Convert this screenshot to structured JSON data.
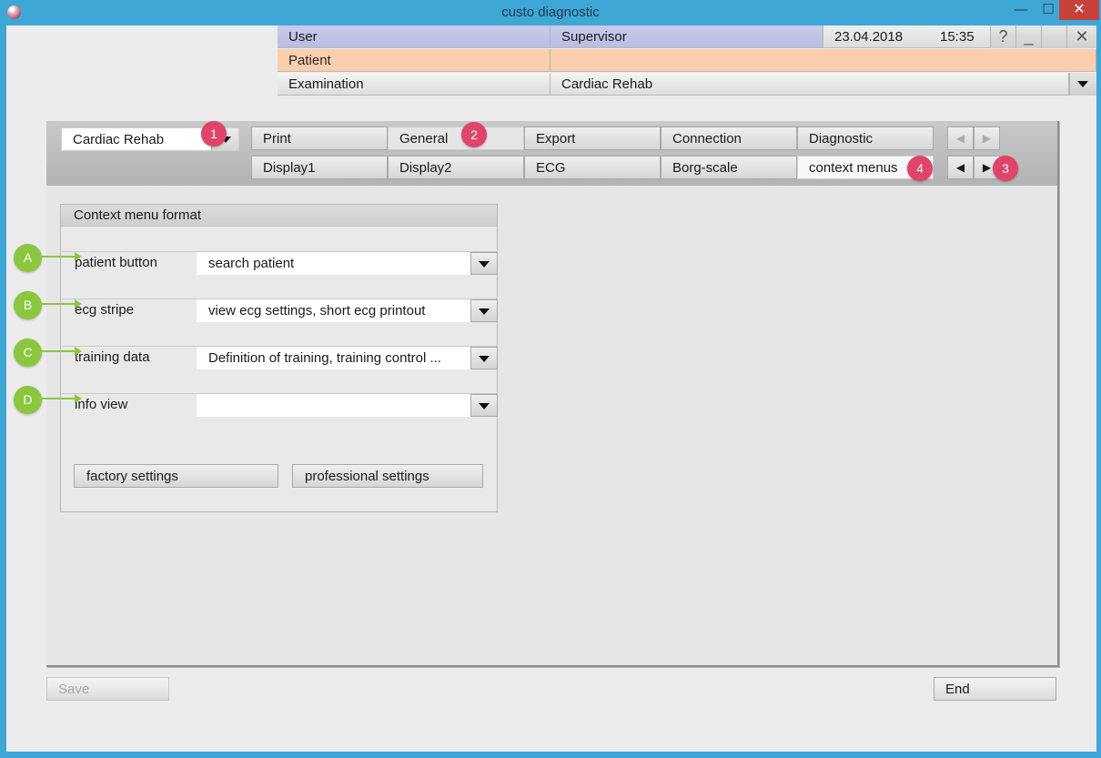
{
  "window": {
    "title": "custo diagnostic"
  },
  "header": {
    "user_label": "User",
    "user_value": "Supervisor",
    "date": "23.04.2018",
    "time": "15:35",
    "help_glyph": "?",
    "minimize_glyph": "_",
    "close_glyph": "✕",
    "patient_label": "Patient",
    "patient_value": "",
    "exam_label": "Examination",
    "exam_value": "Cardiac Rehab"
  },
  "config": {
    "selected": "Cardiac Rehab"
  },
  "tabs_row1": [
    "Print",
    "General",
    "Export",
    "Connection",
    "Diagnostic"
  ],
  "tabs_row2": [
    "Display1",
    "Display2",
    "ECG",
    "Borg-scale",
    "context menus"
  ],
  "badges": [
    "1",
    "2",
    "3",
    "4"
  ],
  "context_menu": {
    "title": "Context menu format",
    "rows": [
      {
        "label": "patient button",
        "value": "search patient",
        "callout": "A"
      },
      {
        "label": "ecg stripe",
        "value": "view ecg settings, short ecg printout",
        "callout": "B"
      },
      {
        "label": "training data",
        "value": "Definition of training, training control ...",
        "callout": "C"
      },
      {
        "label": "info view",
        "value": "",
        "callout": "D"
      }
    ],
    "factory_settings": "factory settings",
    "professional_settings": "professional settings"
  },
  "footer": {
    "save": "Save",
    "end": "End"
  },
  "colors": {
    "titlebar": "#3fa7d6",
    "user_row": "#bfc3e6",
    "patient_row": "#fbceae",
    "badge": "#e0446b",
    "callout": "#8cc63f",
    "close": "#c7413b"
  },
  "icons": [
    "app-orb-icon",
    "minimize-icon",
    "maximize-icon",
    "close-icon",
    "help-icon",
    "dropdown-arrow-icon",
    "prev-arrow-icon",
    "next-arrow-icon"
  ]
}
